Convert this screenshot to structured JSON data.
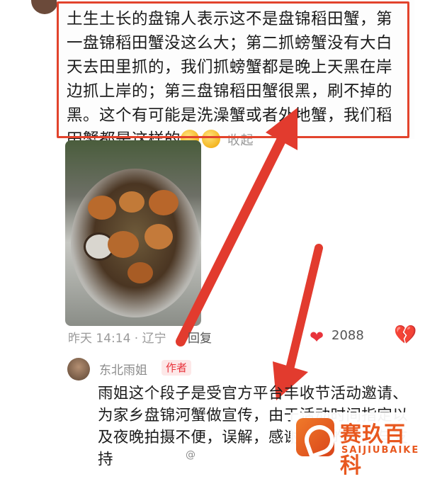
{
  "top_comment": {
    "text": "土生土长的盘锦人表示这不是盘锦稻田蟹，第一盘锦稻田蟹没这么大；第二抓螃蟹没有大白天去田里抓的，我们抓螃蟹都是晚上天黑在岸边抓上岸的；第三盘锦稻田蟹很黑，刷不掉的黑。这个有可能是洗澡蟹或者外地蟹，我们稻田蟹都是这样的",
    "collapse_label": "收起",
    "emoji_icons": [
      "shy-face-icon",
      "shy-face-icon"
    ]
  },
  "meta": {
    "time_location": "昨天 14:14 · 辽宁",
    "reply_label": "回复",
    "like_count": "2088",
    "like_icon": "heart-icon",
    "dislike_icon": "broken-heart-icon"
  },
  "reply": {
    "author": "东北雨姐",
    "badge": "作者",
    "text": "雨姐这个段子是受官方平台丰收节活动邀请、为家乡盘锦河蟹做宣传，由于活动时间指定以及夜晚拍摄不便，误解，感谢大家的关心与支持"
  },
  "watermark": {
    "left_text": "@",
    "logo_cn": "赛玖百科",
    "logo_en": "SAIJIUBAIKE"
  },
  "colors": {
    "highlight": "#e2432c",
    "arrow": "#e23b2e",
    "like": "#e8333b",
    "brand": "#e8581f"
  }
}
